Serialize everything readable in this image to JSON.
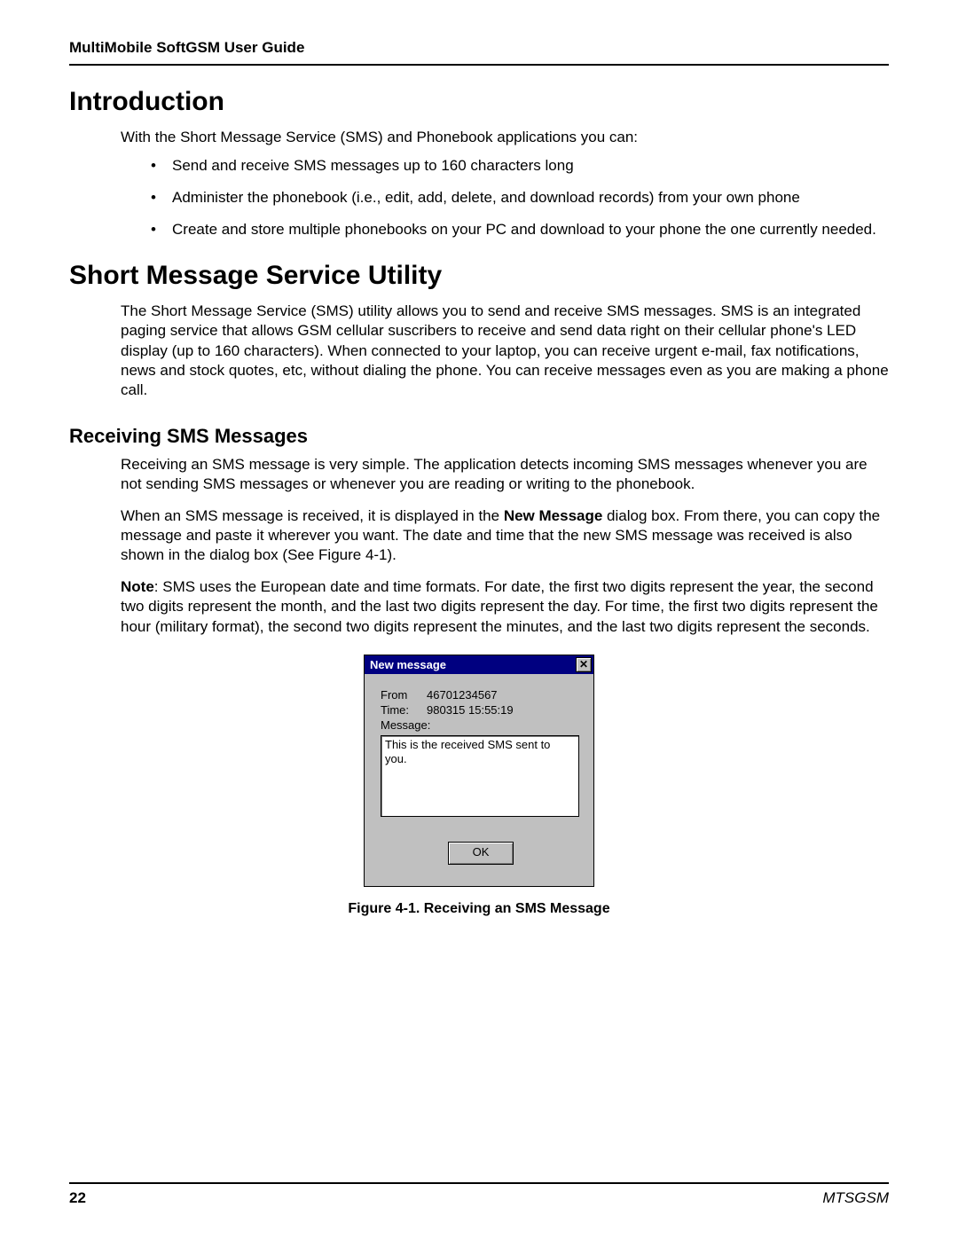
{
  "running_head": "MultiMobile SoftGSM User Guide",
  "intro": {
    "heading": "Introduction",
    "lead": "With the Short Message Service (SMS) and Phonebook applications you can:",
    "bullets": [
      "Send and receive SMS messages up to 160 characters long",
      "Administer the phonebook (i.e., edit, add, delete, and download records) from your own phone",
      "Create and store multiple phonebooks on your PC and download to your phone the one currently needed."
    ]
  },
  "sms_util": {
    "heading": "Short Message Service Utility",
    "para": "The Short Message Service (SMS) utility allows you to send and receive SMS messages. SMS is an integrated paging service that allows GSM cellular suscribers to receive and send data right on their cellular phone's LED display (up to 160 characters). When connected to your laptop, you can receive urgent e-mail, fax notifications, news and stock quotes, etc, without dialing the phone. You can receive messages even as you are making a phone call."
  },
  "receiving": {
    "heading": "Receiving SMS Messages",
    "p1": "Receiving an SMS message is  very simple. The application detects incoming SMS messages whenever you are not sending SMS messages or whenever you are reading or writing to the phonebook.",
    "p2_pre": "When an SMS message is received, it is displayed in the ",
    "p2_bold": "New Message",
    "p2_post": " dialog box. From there, you can copy the message and paste it wherever you want. The date and time that the new SMS message was received is also shown in the dialog box (See Figure 4-1).",
    "note_label": "Note",
    "note_text": ": SMS uses the European date and time formats. For date, the first two digits represent the year, the second two digits represent the month, and the last two digits represent the day. For time, the first two digits represent the hour (military format), the second two digits represent the minutes, and the last two digits represent the seconds."
  },
  "dialog": {
    "title": "New message",
    "close_glyph": "✕",
    "from_label": "From",
    "from_value": "46701234567",
    "time_label": "Time:",
    "time_value": "980315 15:55:19",
    "message_label": "Message:",
    "message_text": "This is the received SMS sent to you.",
    "ok_label": "OK"
  },
  "figure_caption": "Figure 4-1.  Receiving an SMS Message",
  "footer": {
    "page_no": "22",
    "doc_code": "MTSGSM"
  }
}
